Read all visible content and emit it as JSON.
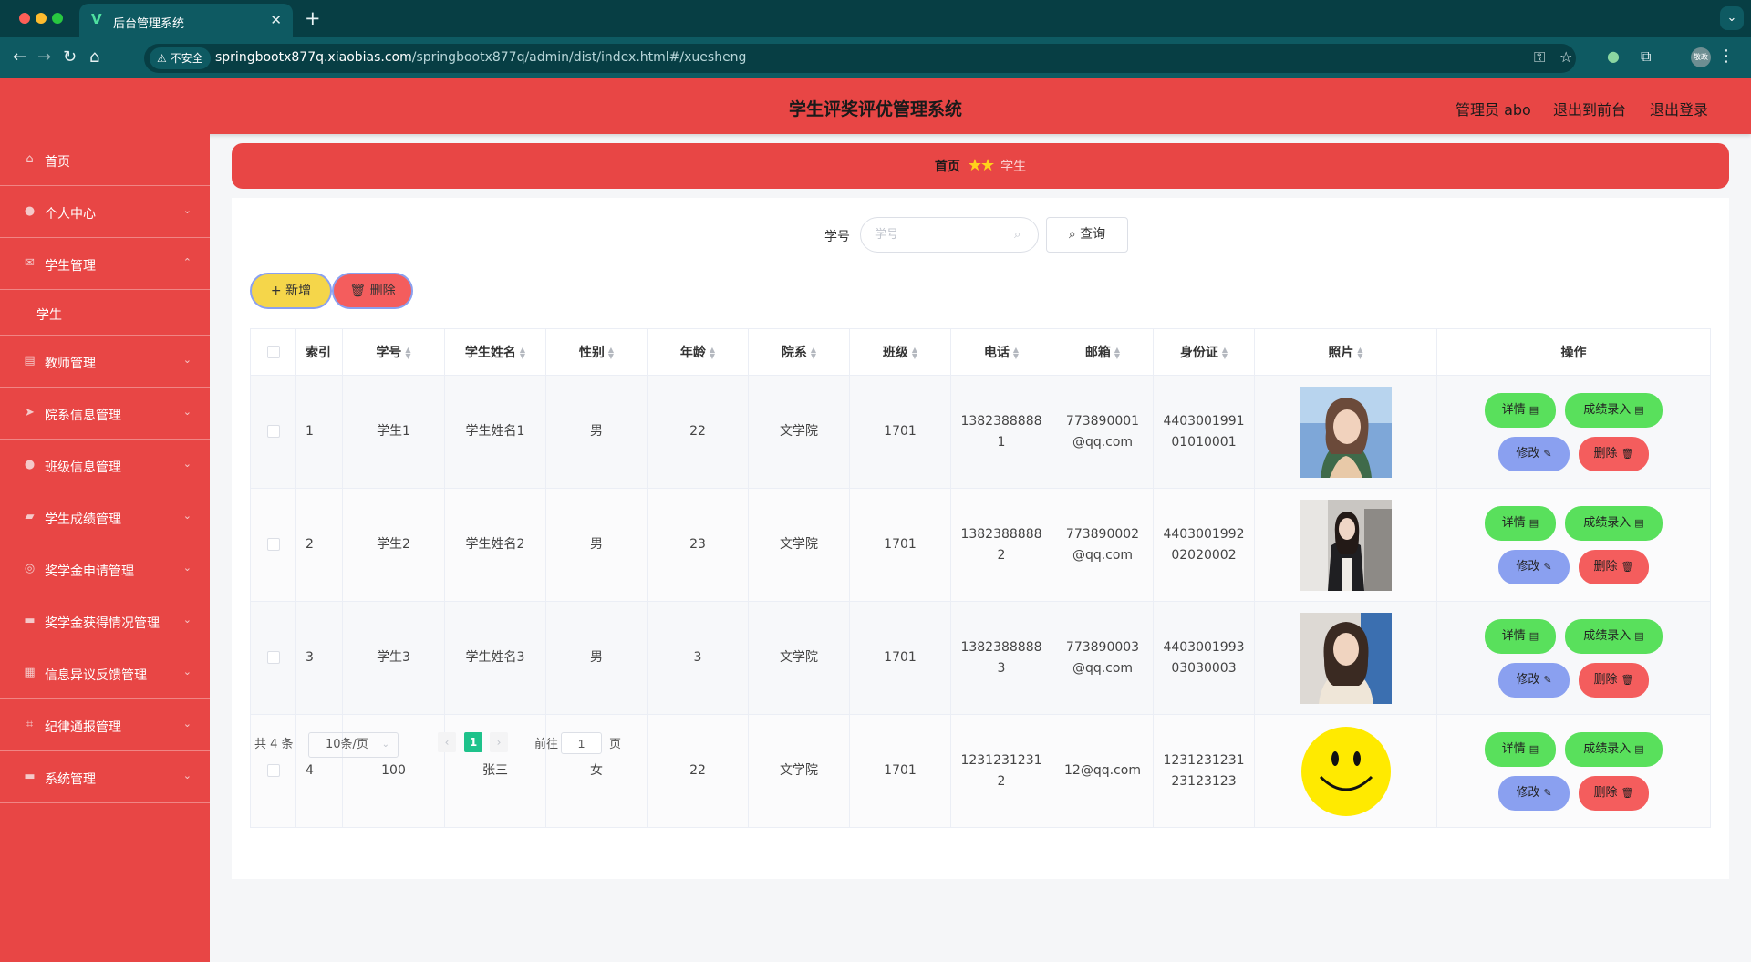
{
  "browser": {
    "tab_title": "后台管理系统",
    "url_host": "springbootx877q.xiaobias.com",
    "url_path": "/springbootx877q/admin/dist/index.html#/xuesheng",
    "insecure_label": "不安全",
    "profile_label": "敬政"
  },
  "header": {
    "title": "学生评奖评优管理系统",
    "user_label": "管理员 abo",
    "frontend_link": "退出到前台",
    "logout_link": "退出登录"
  },
  "sidebar": {
    "items": [
      {
        "label": "首页",
        "icon": "home-icon"
      },
      {
        "label": "个人中心",
        "icon": "user-icon"
      },
      {
        "label": "学生管理",
        "icon": "mail-icon"
      },
      {
        "label": "学生",
        "icon": ""
      },
      {
        "label": "教师管理",
        "icon": "chart-icon"
      },
      {
        "label": "院系信息管理",
        "icon": "send-icon"
      },
      {
        "label": "班级信息管理",
        "icon": "person-icon"
      },
      {
        "label": "学生成绩管理",
        "icon": "briefcase-icon"
      },
      {
        "label": "奖学金申请管理",
        "icon": "compass-icon"
      },
      {
        "label": "奖学金获得情况管理",
        "icon": "chat-icon"
      },
      {
        "label": "信息异议反馈管理",
        "icon": "grid-icon"
      },
      {
        "label": "纪律通报管理",
        "icon": "crop-icon"
      },
      {
        "label": "系统管理",
        "icon": "chat-icon"
      }
    ]
  },
  "breadcrumb": {
    "home": "首页",
    "current": "学生"
  },
  "search": {
    "label": "学号",
    "placeholder": "学号",
    "button": "查询"
  },
  "actions": {
    "add": "新增",
    "delete": "删除"
  },
  "table": {
    "headers": [
      "索引",
      "学号",
      "学生姓名",
      "性别",
      "年龄",
      "院系",
      "班级",
      "电话",
      "邮箱",
      "身份证",
      "照片",
      "操作"
    ],
    "op_labels": {
      "detail": "详情",
      "grade": "成绩录入",
      "edit": "修改",
      "delete": "删除"
    },
    "rows": [
      {
        "index": "1",
        "xuehao": "学生1",
        "name": "学生姓名1",
        "gender": "男",
        "age": "22",
        "dept": "文学院",
        "class": "1701",
        "phone": "13823888881",
        "email": "773890001@qq.com",
        "idcard": "440300199101010001",
        "photo": "portrait-photo-1"
      },
      {
        "index": "2",
        "xuehao": "学生2",
        "name": "学生姓名2",
        "gender": "男",
        "age": "23",
        "dept": "文学院",
        "class": "1701",
        "phone": "13823888882",
        "email": "773890002@qq.com",
        "idcard": "440300199202020002",
        "photo": "portrait-photo-2"
      },
      {
        "index": "3",
        "xuehao": "学生3",
        "name": "学生姓名3",
        "gender": "男",
        "age": "3",
        "dept": "文学院",
        "class": "1701",
        "phone": "13823888883",
        "email": "773890003@qq.com",
        "idcard": "440300199303030003",
        "photo": "portrait-photo-3"
      },
      {
        "index": "4",
        "xuehao": "100",
        "name": "张三",
        "gender": "女",
        "age": "22",
        "dept": "文学院",
        "class": "1701",
        "phone": "12312312312",
        "email": "12@qq.com",
        "idcard": "123123123123123123",
        "photo": "smiley-photo"
      }
    ]
  },
  "pagination": {
    "total": "共 4 条",
    "page_size": "10条/页",
    "current_page": "1",
    "goto_label": "前往",
    "goto_value": "1",
    "page_suffix": "页"
  },
  "colors": {
    "primary": "#e84645",
    "success": "#59e05c",
    "info": "#8aa0f0",
    "warning": "#f5d64a",
    "danger": "#f45d5d",
    "page_active": "#1ec28b"
  }
}
